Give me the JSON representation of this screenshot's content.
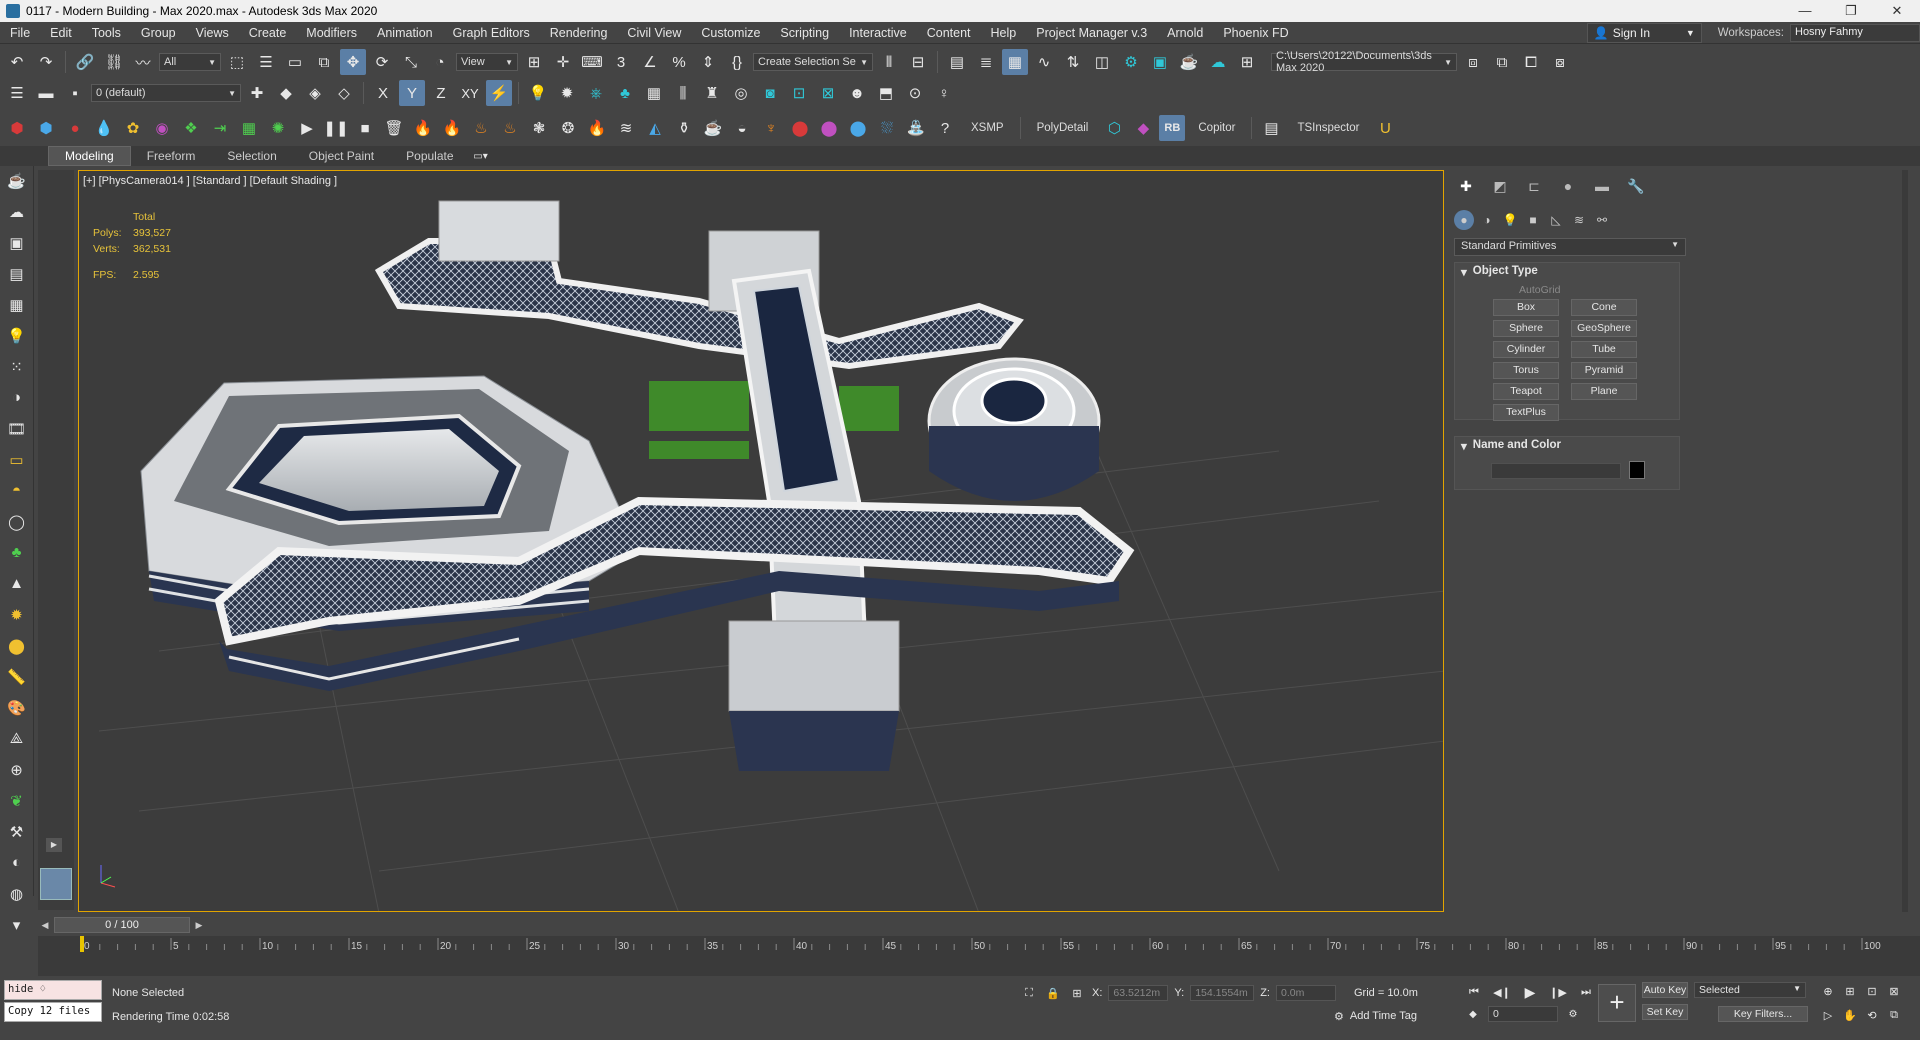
{
  "window": {
    "title": "0117 - Modern Building - Max 2020.max - Autodesk 3ds Max 2020",
    "controls": [
      "—",
      "❐",
      "✕"
    ]
  },
  "menu": {
    "items": [
      "File",
      "Edit",
      "Tools",
      "Group",
      "Views",
      "Create",
      "Modifiers",
      "Animation",
      "Graph Editors",
      "Rendering",
      "Civil View",
      "Customize",
      "Scripting",
      "Interactive",
      "Content",
      "Help",
      "Project Manager v.3",
      "Arnold",
      "Phoenix FD"
    ],
    "sign_in": "Sign In",
    "workspaces_label": "Workspaces:",
    "workspace_value": "Hosny Fahmy"
  },
  "toolbar1": {
    "filter_value": "All",
    "refcoord_value": "View",
    "selection_set_value": "Create Selection Se",
    "project_path": "C:\\Users\\20122\\Documents\\3ds Max 2020"
  },
  "toolbar2": {
    "layer_value": "0 (default)",
    "axis_x": "X",
    "axis_y": "Y",
    "axis_z": "Z",
    "axis_xy": "XY"
  },
  "toolbar3": {
    "xsmp": "XSMP",
    "polydetail": "PolyDetail",
    "rb": "RB",
    "copitor": "Copitor",
    "tsinspector": "TSInspector"
  },
  "ribbon": {
    "tabs": [
      "Modeling",
      "Freeform",
      "Selection",
      "Object Paint",
      "Populate"
    ]
  },
  "viewport": {
    "label": "[+] [PhysCamera014 ] [Standard ] [Default Shading ]",
    "stats": {
      "total_label": "Total",
      "polys_label": "Polys:",
      "polys": "393,527",
      "verts_label": "Verts:",
      "verts": "362,531",
      "fps_label": "FPS:",
      "fps": "2.595"
    }
  },
  "command_panel": {
    "dropdown": "Standard Primitives",
    "object_type_title": "Object Type",
    "autogrid": "AutoGrid",
    "primitives": [
      "Box",
      "Cone",
      "Sphere",
      "GeoSphere",
      "Cylinder",
      "Tube",
      "Torus",
      "Pyramid",
      "Teapot",
      "Plane",
      "TextPlus"
    ],
    "name_color_title": "Name and Color"
  },
  "timeline": {
    "frame_display": "0 / 100",
    "ticks": [
      "0",
      "5",
      "10",
      "15",
      "20",
      "25",
      "30",
      "35",
      "40",
      "45",
      "50",
      "55",
      "60",
      "65",
      "70",
      "75",
      "80",
      "85",
      "90",
      "95",
      "100"
    ]
  },
  "status": {
    "script_input": "hide ♢",
    "script_output": "Copy 12 files",
    "selection": "None Selected",
    "prompt": "Rendering Time  0:02:58",
    "x_label": "X:",
    "x_value": "63.5212m",
    "y_label": "Y:",
    "y_value": "154.1554m",
    "z_label": "Z:",
    "z_value": "0.0m",
    "grid": "Grid = 10.0m",
    "add_time_tag": "Add Time Tag",
    "frame_value": "0",
    "auto_key": "Auto Key",
    "set_key": "Set Key",
    "key_mode": "Selected",
    "key_filters": "Key Filters..."
  }
}
